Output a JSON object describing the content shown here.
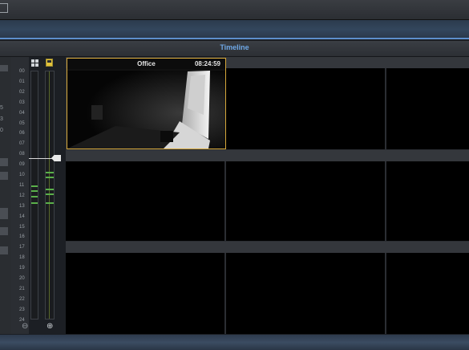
{
  "panel": {
    "title": "Timeline"
  },
  "timeline": {
    "hours": [
      "00",
      "01",
      "02",
      "03",
      "04",
      "05",
      "06",
      "07",
      "08",
      "09",
      "10",
      "11",
      "12",
      "13",
      "14",
      "15",
      "16",
      "17",
      "18",
      "19",
      "20",
      "21",
      "22",
      "23",
      "24"
    ],
    "cursor_hour": "09"
  },
  "left_strip": {
    "fragments": [
      "5",
      "3",
      "0"
    ]
  },
  "camera": {
    "name": "Office",
    "time": "08:24:59"
  },
  "colors": {
    "accent": "#6fa8e6",
    "selection": "#d7a83a",
    "recording": "#5ab04a"
  },
  "icons": {
    "layout": "grid-layout-icon",
    "single": "single-view-icon",
    "zoom_out": "zoom-out-icon",
    "zoom_in": "zoom-in-icon"
  }
}
